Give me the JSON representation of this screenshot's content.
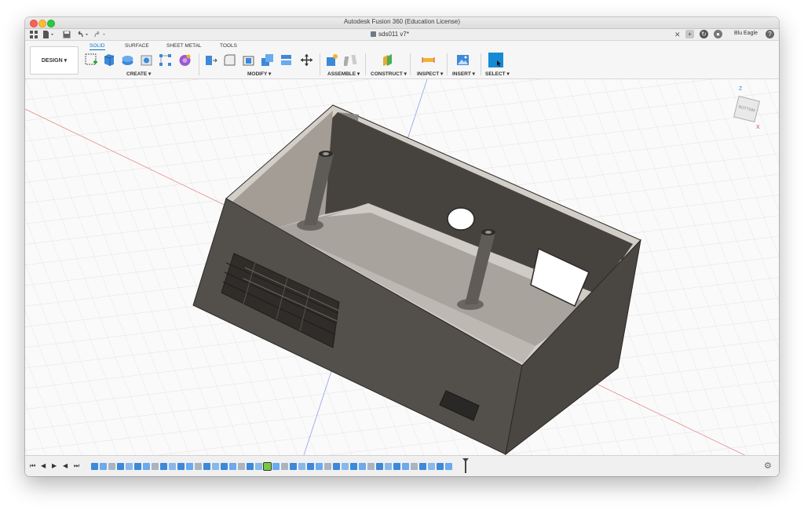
{
  "window": {
    "title": "Autodesk Fusion 360 (Education License)",
    "document_tab": "sds011 v7*",
    "user": "Blu Eagle",
    "help": "?"
  },
  "toolbar": {
    "workspace": "DESIGN ▾",
    "tabs": [
      "SOLID",
      "SURFACE",
      "SHEET METAL",
      "TOOLS"
    ],
    "active_tab": "SOLID",
    "groups": {
      "create": "CREATE ▾",
      "modify": "MODIFY ▾",
      "assemble": "ASSEMBLE ▾",
      "construct": "CONSTRUCT ▾",
      "inspect": "INSPECT ▾",
      "insert": "INSERT ▾",
      "select": "SELECT ▾"
    }
  },
  "viewcube": {
    "z_label": "Z",
    "x_label": "X",
    "face_label": "BOTTOM"
  },
  "timeline": {
    "controls": [
      "⏮",
      "◀",
      "▶",
      "⏭"
    ],
    "item_count": 42,
    "selected_index": 20
  },
  "colors": {
    "accent": "#0a73c9",
    "model": "#55524d",
    "grid": "#d6d6d6",
    "axis_red": "#e07070",
    "axis_blue": "#7a8fe6"
  }
}
